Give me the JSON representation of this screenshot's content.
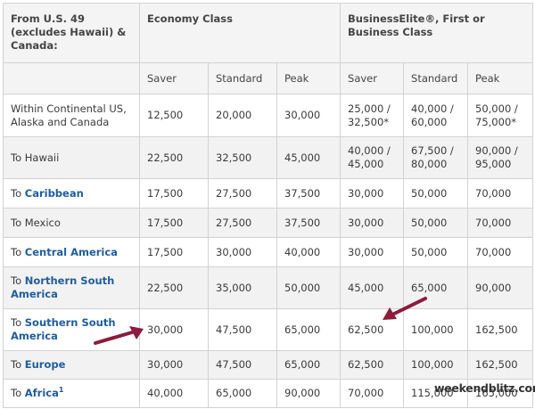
{
  "header": {
    "region_label": "From U.S. 49 (excludes Hawaii) & Canada:",
    "economy_label": "Economy Class",
    "business_label": "BusinessElite®, First or Business Class"
  },
  "subheader": [
    "Saver",
    "Standard",
    "Peak",
    "Saver",
    "Standard",
    "Peak"
  ],
  "rows": [
    {
      "region_prefix": "",
      "region_link": "",
      "region_plain": "Within Continental US, Alaska and Canada",
      "footnote": "",
      "values": [
        "12,500",
        "20,000",
        "30,000",
        "25,000 / 32,500*",
        "40,000 / 60,000",
        "50,000 / 75,000*"
      ]
    },
    {
      "region_prefix": "",
      "region_link": "",
      "region_plain": "To Hawaii",
      "footnote": "",
      "values": [
        "22,500",
        "32,500",
        "45,000",
        "40,000 / 45,000",
        "67,500 / 80,000",
        "90,000 / 95,000"
      ]
    },
    {
      "region_prefix": "To ",
      "region_link": "Caribbean",
      "region_plain": "",
      "footnote": "",
      "values": [
        "17,500",
        "27,500",
        "37,500",
        "30,000",
        "50,000",
        "70,000"
      ]
    },
    {
      "region_prefix": "",
      "region_link": "",
      "region_plain": "To Mexico",
      "footnote": "",
      "values": [
        "17,500",
        "27,500",
        "37,500",
        "30,000",
        "50,000",
        "70,000"
      ]
    },
    {
      "region_prefix": "To ",
      "region_link": "Central America",
      "region_plain": "",
      "footnote": "",
      "values": [
        "17,500",
        "30,000",
        "40,000",
        "30,000",
        "50,000",
        "70,000"
      ]
    },
    {
      "region_prefix": "To ",
      "region_link": "Northern South America",
      "region_plain": "",
      "footnote": "",
      "values": [
        "22,500",
        "35,000",
        "50,000",
        "45,000",
        "65,000",
        "90,000"
      ]
    },
    {
      "region_prefix": "To ",
      "region_link": "Southern South America",
      "region_plain": "",
      "footnote": "",
      "values": [
        "30,000",
        "47,500",
        "65,000",
        "62,500",
        "100,000",
        "162,500"
      ]
    },
    {
      "region_prefix": "To ",
      "region_link": "Europe",
      "region_plain": "",
      "footnote": "",
      "values": [
        "30,000",
        "47,500",
        "65,000",
        "62,500",
        "100,000",
        "162,500"
      ]
    },
    {
      "region_prefix": "To ",
      "region_link": "Africa",
      "region_plain": "",
      "footnote": "1",
      "values": [
        "40,000",
        "65,000",
        "90,000",
        "70,000",
        "115,000",
        "165,000"
      ]
    }
  ],
  "watermark": "weekendblitz.com",
  "colors": {
    "link": "#1f5d9e",
    "arrow": "#8c1b3e",
    "border": "#d2d2d2",
    "band": "#f2f2f2"
  }
}
